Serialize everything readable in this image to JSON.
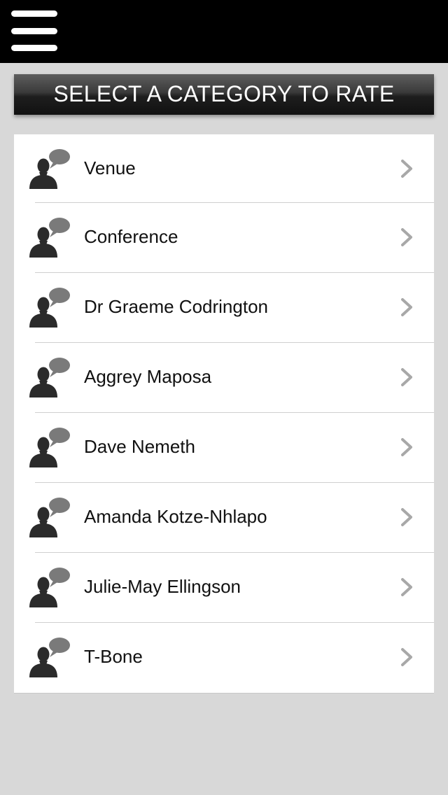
{
  "header": {
    "menu_icon": "hamburger-menu-icon"
  },
  "section": {
    "title": "SELECT A CATEGORY TO RATE"
  },
  "categories": [
    {
      "label": "Venue",
      "icon": "speaker-speech-bubble-icon"
    },
    {
      "label": "Conference",
      "icon": "speaker-speech-bubble-icon"
    },
    {
      "label": "Dr Graeme Codrington",
      "icon": "speaker-speech-bubble-icon"
    },
    {
      "label": "Aggrey Maposa",
      "icon": "speaker-speech-bubble-icon"
    },
    {
      "label": "Dave Nemeth",
      "icon": "speaker-speech-bubble-icon"
    },
    {
      "label": "Amanda Kotze-Nhlapo",
      "icon": "speaker-speech-bubble-icon"
    },
    {
      "label": "Julie-May Ellingson",
      "icon": "speaker-speech-bubble-icon"
    },
    {
      "label": "T-Bone",
      "icon": "speaker-speech-bubble-icon"
    }
  ],
  "colors": {
    "top_bar": "#000000",
    "background": "#d8d8d8",
    "header_gradient_top": "#5e5e5e",
    "header_gradient_bottom": "#111111",
    "list_background": "#ffffff",
    "chevron": "#a8a8a8",
    "icon_person": "#2b2b2b",
    "icon_bubble": "#7a7a7a"
  }
}
